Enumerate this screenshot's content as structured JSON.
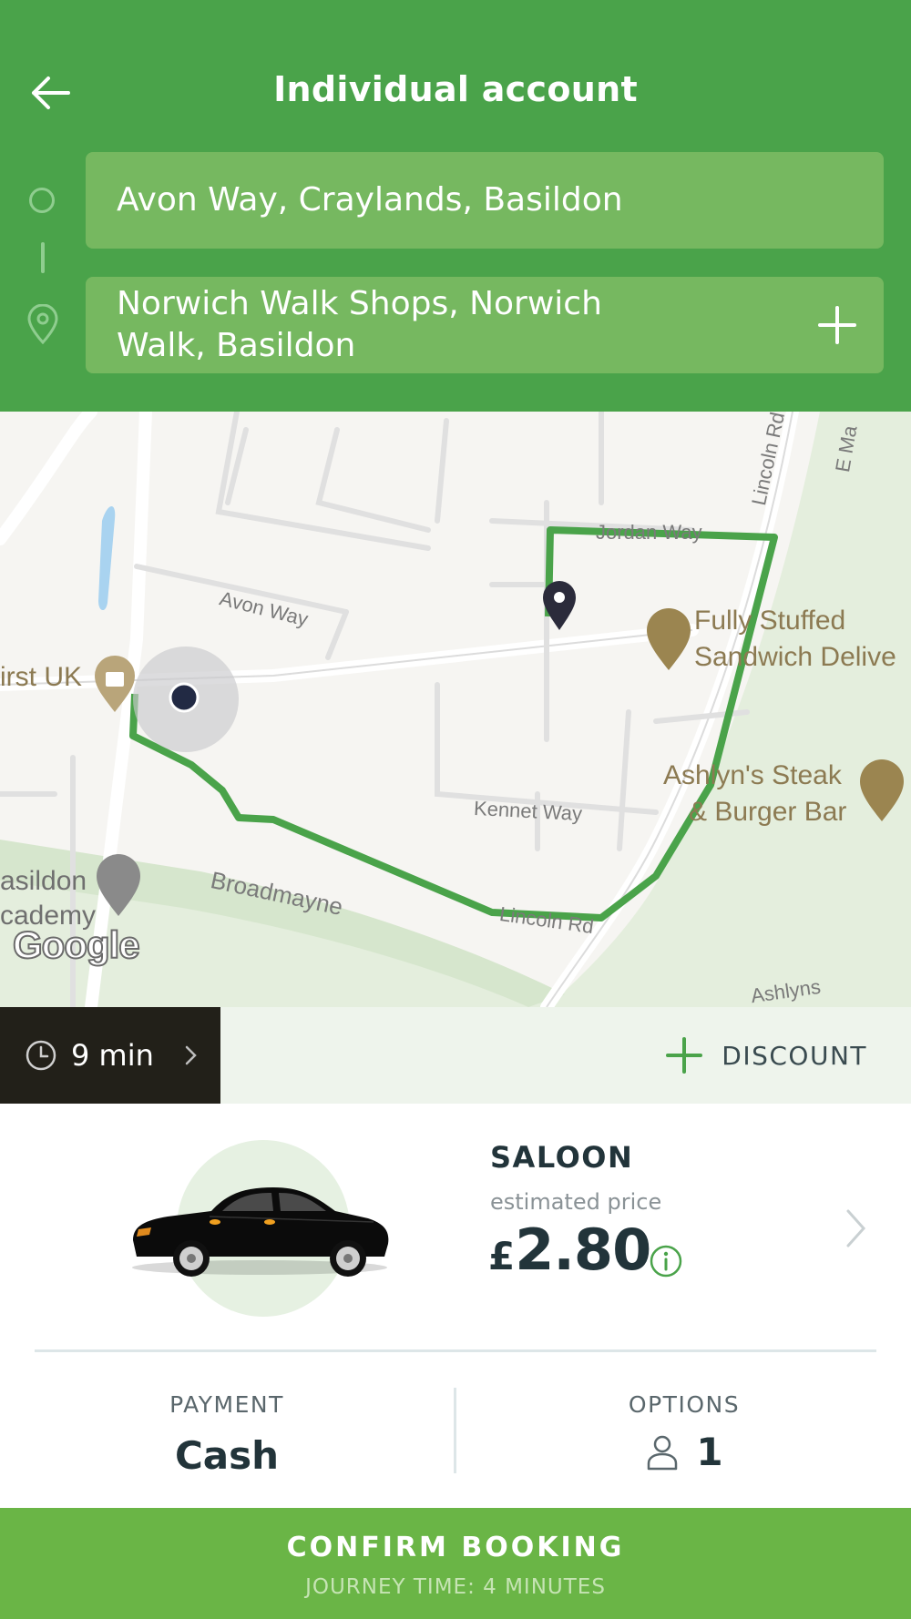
{
  "header": {
    "title": "Individual account",
    "back_icon": "arrow-left-icon",
    "pickup": "Avon Way, Craylands, Basildon",
    "dropoff": "Norwich Walk Shops, Norwich Walk, Basildon",
    "add_stop_icon": "plus-icon"
  },
  "map": {
    "street_labels": [
      "Avon Way",
      "Jordan Way",
      "Lincoln Rd",
      "Kennet Way",
      "Broadmayne",
      "Lincoln Rd",
      "E Ma",
      "Ashlyns"
    ],
    "poi": {
      "first_uk": "irst UK",
      "fully_stuffed_1": "Fully Stuffed",
      "fully_stuffed_2": "Sandwich Delive",
      "ashlyns_1": "Ashlyn's Steak",
      "ashlyns_2": "& Burger Bar",
      "basildon_1": "asildon",
      "basildon_2": "cademy"
    },
    "attribution": "Google",
    "route_color": "#4aa34a"
  },
  "info_bar": {
    "eta": "9 min",
    "discount_label": "DISCOUNT"
  },
  "vehicle": {
    "name": "SALOON",
    "price_caption": "estimated price",
    "currency": "£",
    "amount": "2.80"
  },
  "payment": {
    "label": "PAYMENT",
    "value": "Cash"
  },
  "options": {
    "label": "OPTIONS",
    "passengers": "1"
  },
  "confirm": {
    "label": "CONFIRM BOOKING",
    "journey_time": "JOURNEY TIME: 4 MINUTES"
  },
  "colors": {
    "header_green": "#4aa34a",
    "field_green": "#76b860",
    "confirm_green": "#6ab546",
    "eta_dark": "#222019",
    "text_dark": "#22343a"
  }
}
